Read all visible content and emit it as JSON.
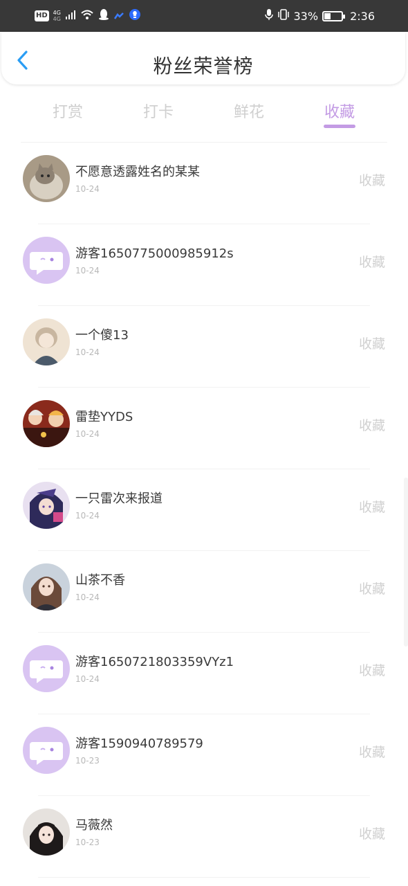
{
  "status_bar": {
    "hd": "HD",
    "network_top": "4G",
    "network_bottom": "4G",
    "battery_percent": "33%",
    "time": "2:36",
    "battery_level": 0.33,
    "icons": [
      "signal-icon",
      "wifi-icon",
      "qq-icon",
      "cloud-icon",
      "shield-icon",
      "mic-icon",
      "vibrate-icon",
      "battery-icon"
    ]
  },
  "nav": {
    "title": "粉丝荣誉榜"
  },
  "tabs": [
    {
      "label": "打赏"
    },
    {
      "label": "打卡"
    },
    {
      "label": "鲜花"
    },
    {
      "label": "收藏"
    }
  ],
  "active_tab": "收藏",
  "accent_color": "#c39be4",
  "rows": [
    {
      "name": "不愿意透露姓名的某某",
      "date": "10-24",
      "action": "收藏",
      "avatar": "cat-photo"
    },
    {
      "name": "游客1650775000985912s",
      "date": "10-24",
      "action": "收藏",
      "avatar": "default-chat"
    },
    {
      "name": "一个傻13",
      "date": "10-24",
      "action": "收藏",
      "avatar": "anime-boy"
    },
    {
      "name": "雷垫YYDS",
      "date": "10-24",
      "action": "收藏",
      "avatar": "anime-group"
    },
    {
      "name": "一只雷次来报道",
      "date": "10-24",
      "action": "收藏",
      "avatar": "anime-girl-purple"
    },
    {
      "name": "山茶不香",
      "date": "10-24",
      "action": "收藏",
      "avatar": "anime-girl-brown"
    },
    {
      "name": "游客1650721803359VYz1",
      "date": "10-24",
      "action": "收藏",
      "avatar": "default-chat"
    },
    {
      "name": "游客1590940789579",
      "date": "10-23",
      "action": "收藏",
      "avatar": "default-chat"
    },
    {
      "name": "马薇然",
      "date": "10-23",
      "action": "收藏",
      "avatar": "girl-photo"
    }
  ]
}
